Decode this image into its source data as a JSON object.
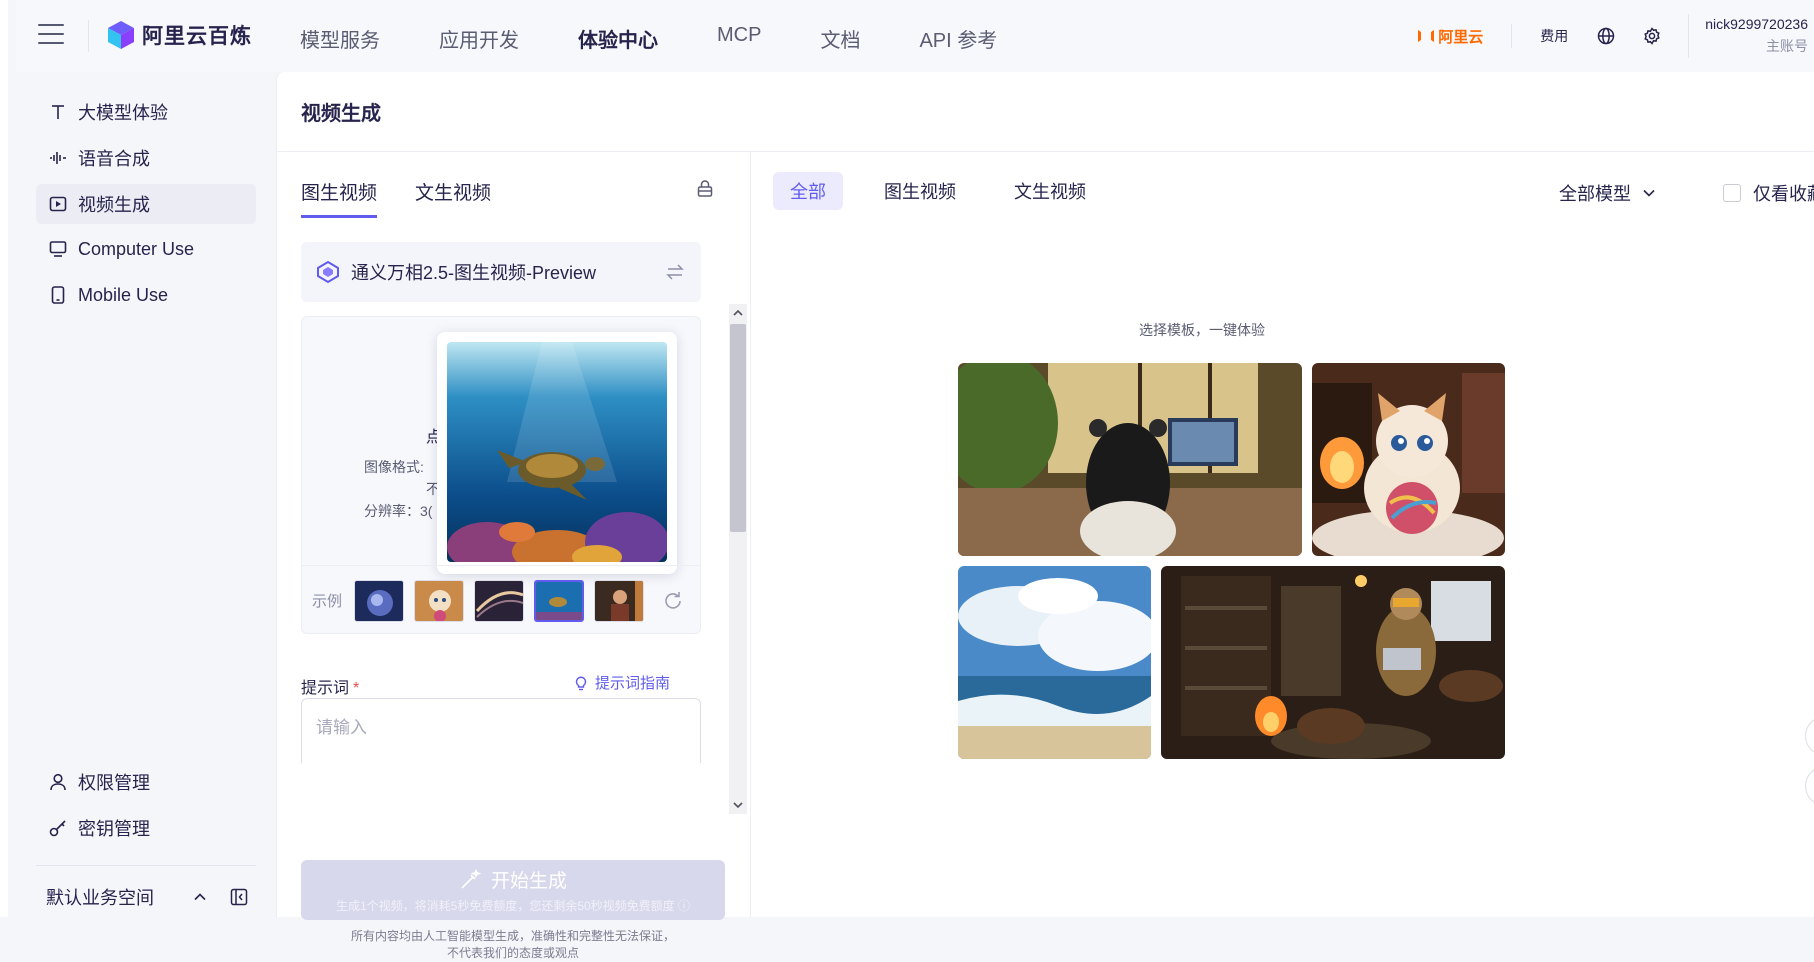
{
  "header": {
    "brand": "阿里云百炼",
    "nav": [
      "模型服务",
      "应用开发",
      "体验中心",
      "MCP",
      "文档",
      "API 参考"
    ],
    "active_nav_index": 2,
    "aliyun_label": "阿里云",
    "fee_label": "费用",
    "user_name": "nick9299720236",
    "user_role": "主账号"
  },
  "sidebar": {
    "items": [
      {
        "label": "大模型体验",
        "icon": "text-icon"
      },
      {
        "label": "语音合成",
        "icon": "audio-wave-icon"
      },
      {
        "label": "视频生成",
        "icon": "video-icon"
      },
      {
        "label": "Computer Use",
        "icon": "monitor-icon"
      },
      {
        "label": "Mobile Use",
        "icon": "mobile-icon"
      }
    ],
    "bottom_items": [
      {
        "label": "权限管理",
        "icon": "user-icon"
      },
      {
        "label": "密钥管理",
        "icon": "key-icon"
      }
    ],
    "workspace": "默认业务空间"
  },
  "page": {
    "title": "视频生成"
  },
  "left_pane": {
    "tabs": [
      "图生视频",
      "文生视频"
    ],
    "active_tab": 0,
    "model_name": "通义万相2.5-图生视频-Preview",
    "upload": {
      "title_fragment": "点",
      "format_label": "图像格式:",
      "line2": "不",
      "resolution_label": "分辨率：3("
    },
    "examples_label": "示例",
    "prompt_label": "提示词",
    "prompt_required": "*",
    "prompt_guide": "提示词指南",
    "prompt_placeholder": "请输入",
    "generate_label": "开始生成",
    "generate_sub": "生成1个视频，将消耗5秒免费额度，您还剩余50秒视频免费额度",
    "disclaimer_line1": "所有内容均由人工智能模型生成，准确性和完整性无法保证，",
    "disclaimer_line2": "不代表我们的态度或观点"
  },
  "right_pane": {
    "filters": [
      "全部",
      "图生视频",
      "文生视频"
    ],
    "active_filter": 0,
    "model_filter": "全部模型",
    "favorites_only": "仅看收藏",
    "template_hint": "选择模板，一键体验"
  },
  "colors": {
    "accent": "#615ced",
    "brand_orange": "#ff6a00",
    "required": "#e94b4b"
  }
}
